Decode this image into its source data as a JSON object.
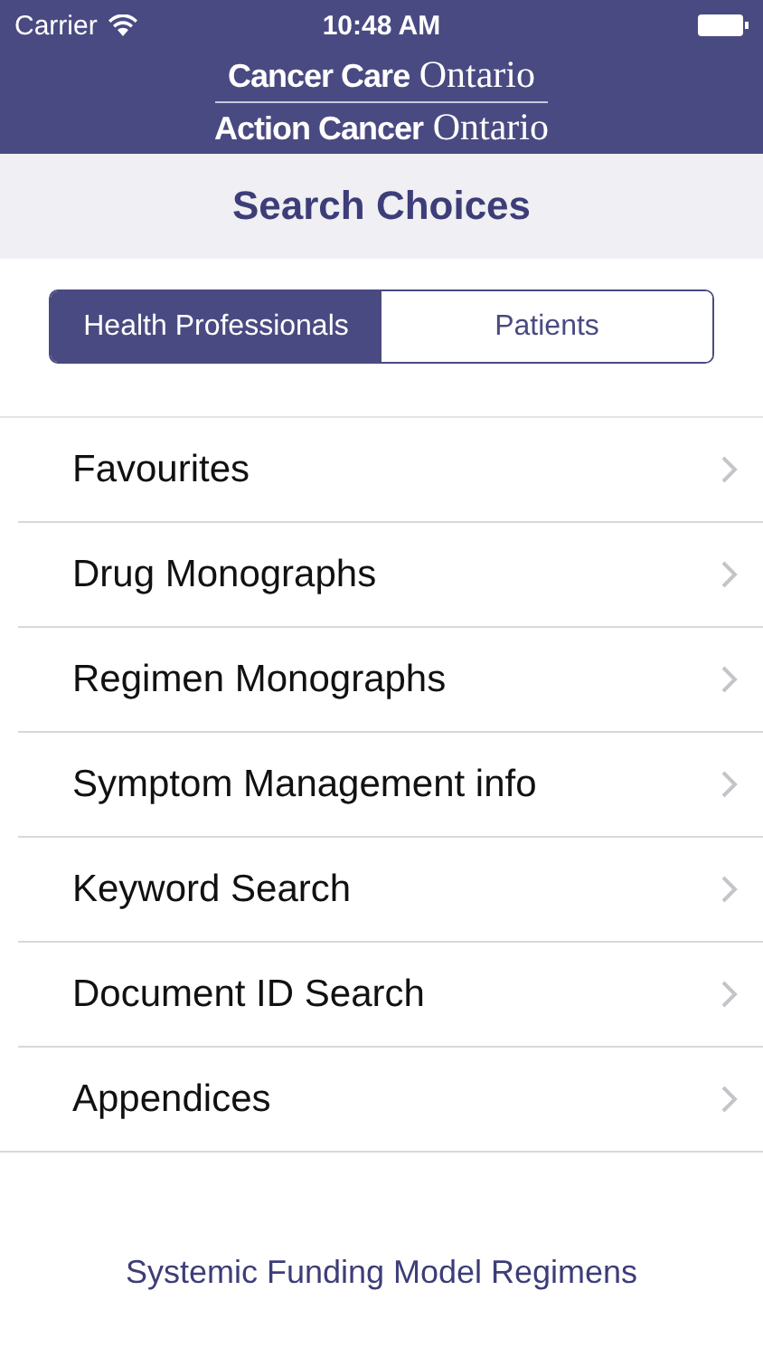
{
  "status_bar": {
    "carrier": "Carrier",
    "time": "10:48 AM"
  },
  "logo": {
    "lines": [
      "**Cancer Care** Ontario",
      "**Action Cancer** Ontario"
    ]
  },
  "title": "Search Choices",
  "segments": [
    {
      "label": "Health Professionals",
      "selected": true
    },
    {
      "label": "Patients",
      "selected": false
    }
  ],
  "menu": [
    {
      "label": "Favourites"
    },
    {
      "label": "Drug Monographs"
    },
    {
      "label": "Regimen Monographs"
    },
    {
      "label": "Symptom Management info"
    },
    {
      "label": "Keyword Search"
    },
    {
      "label": "Document ID Search"
    },
    {
      "label": "Appendices"
    }
  ],
  "footer_link": "Systemic Funding Model Regimens"
}
